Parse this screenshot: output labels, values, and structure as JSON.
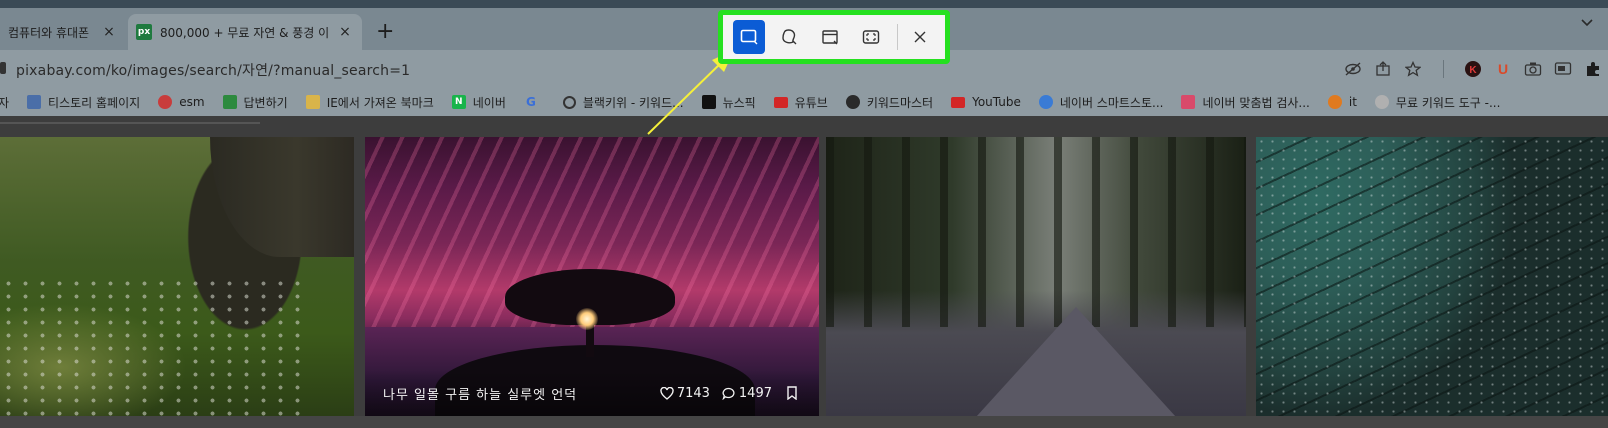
{
  "tabs": [
    {
      "title": "컴퓨터와 휴대폰",
      "active": false
    },
    {
      "title": "800,000 + 무료 자연 & 풍경 이",
      "active": true,
      "favicon": "px"
    }
  ],
  "new_tab_label": "+",
  "address_bar": {
    "url": "pixabay.com/ko/images/search/자연/?manual_search=1"
  },
  "snip_toolbar": {
    "modes": [
      {
        "name": "rectangle-mode",
        "selected": true
      },
      {
        "name": "freeform-mode",
        "selected": false
      },
      {
        "name": "window-mode",
        "selected": false
      },
      {
        "name": "fullscreen-mode",
        "selected": false
      }
    ],
    "highlight_color": "#25e01f",
    "accent_color": "#0b5cd5"
  },
  "bookmarks": [
    {
      "label": "자",
      "icon_color": "#8f9ba2"
    },
    {
      "label": "티스토리 홈페이지",
      "icon_color": "#4a6ea8"
    },
    {
      "label": "esm",
      "icon_color": "#c83c3c"
    },
    {
      "label": "답변하기",
      "icon_color": "#2d8a3e"
    },
    {
      "label": "IE에서 가져온 북마크",
      "icon_color": "#d9b44a"
    },
    {
      "label": "네이버",
      "icon_color": "#19b44b",
      "glyph": "N"
    },
    {
      "label": "",
      "icon_color": "#8f9ba2",
      "glyph": "G"
    },
    {
      "label": "블랙키위 - 키워드...",
      "icon_color": "#333333"
    },
    {
      "label": "뉴스픽",
      "icon_color": "#111111"
    },
    {
      "label": "유튜브",
      "icon_color": "#d32626"
    },
    {
      "label": "키워드마스터",
      "icon_color": "#2a2a2a"
    },
    {
      "label": "YouTube",
      "icon_color": "#d32626"
    },
    {
      "label": "네이버 스마트스토...",
      "icon_color": "#3a7bd5"
    },
    {
      "label": "네이버 맞춤법 검사...",
      "icon_color": "#d94a6a"
    },
    {
      "label": "it",
      "icon_color": "#e07a1f"
    },
    {
      "label": "무료 키워드 도구 -...",
      "icon_color": "#b0b0b0"
    }
  ],
  "photos": [
    {
      "name": "forest-meadow"
    },
    {
      "name": "sunset-tree",
      "caption": "나무  일몰  구름  하늘  실루엣  언덕",
      "likes": "7143",
      "comments": "1497"
    },
    {
      "name": "forest-road"
    },
    {
      "name": "dandelion-dew"
    }
  ]
}
